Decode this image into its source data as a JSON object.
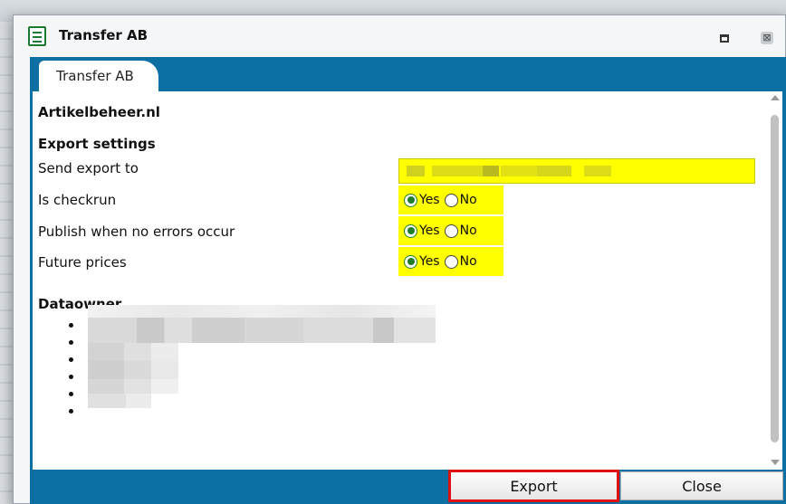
{
  "window": {
    "title": "Transfer AB",
    "icon": "form-icon",
    "controls": {
      "maximize_icon": "maximize-icon",
      "close_glyph": "⊠"
    }
  },
  "tabs": [
    {
      "label": "Transfer AB",
      "active": true
    }
  ],
  "content": {
    "heading": "Artikelbeheer.nl",
    "export_settings": {
      "title": "Export settings",
      "send_export_to": {
        "label": "Send export to",
        "value": ""
      },
      "is_checkrun": {
        "label": "Is checkrun",
        "options": [
          "Yes",
          "No"
        ],
        "selected": "Yes"
      },
      "publish_no_errors": {
        "label": "Publish when no errors occur",
        "options": [
          "Yes",
          "No"
        ],
        "selected": "Yes"
      },
      "future_prices": {
        "label": "Future prices",
        "options": [
          "Yes",
          "No"
        ],
        "selected": "Yes"
      }
    },
    "dataowner": {
      "title": "Dataowner",
      "item_count": 6
    }
  },
  "buttons": {
    "export": "Export",
    "close": "Close"
  },
  "colors": {
    "frame": "#0e6fa2",
    "highlight": "#ffff00",
    "radio_checked": "#1f7d2a",
    "export_outline": "#e01010"
  }
}
